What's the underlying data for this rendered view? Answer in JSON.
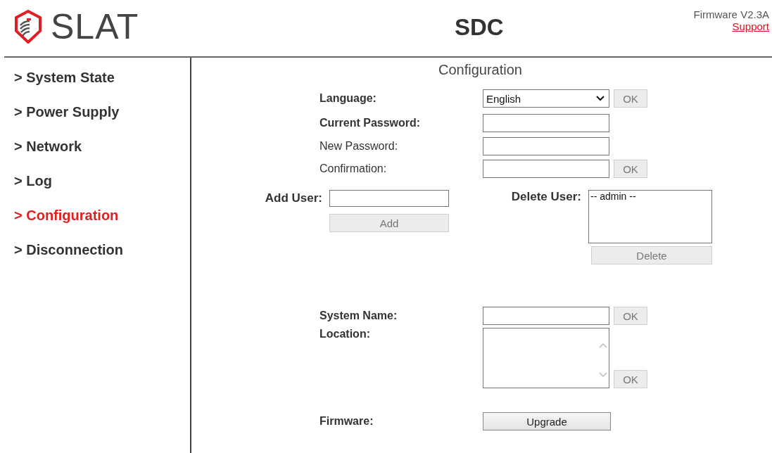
{
  "header": {
    "brand": "SLAT",
    "title": "SDC",
    "firmware": "Firmware V2.3A",
    "support_link": "Support"
  },
  "sidebar": {
    "items": [
      {
        "label": "> System State",
        "selected": false
      },
      {
        "label": "> Power Supply",
        "selected": false
      },
      {
        "label": "> Network",
        "selected": false
      },
      {
        "label": "> Log",
        "selected": false
      },
      {
        "label": "> Configuration",
        "selected": true
      },
      {
        "label": "> Disconnection",
        "selected": false
      }
    ]
  },
  "content": {
    "title": "Configuration",
    "language": {
      "label": "Language:",
      "bold": true,
      "value": "English",
      "button": {
        "label": "OK",
        "disabled": true
      }
    },
    "password_fields": [
      {
        "label": "Current Password:",
        "bold": true
      },
      {
        "label": "New Password:",
        "bold": false
      },
      {
        "label": "Confirmation:",
        "bold": false,
        "button": {
          "label": "OK",
          "disabled": true
        }
      }
    ],
    "add_user": {
      "label": "Add User:",
      "button": {
        "label": "Add",
        "disabled": true
      }
    },
    "delete_user": {
      "label": "Delete User:",
      "options": [
        "-- admin --"
      ],
      "button": {
        "label": "Delete",
        "disabled": true
      }
    },
    "system_name": {
      "label": "System Name:",
      "button": {
        "label": "OK",
        "disabled": true
      }
    },
    "location": {
      "label": "Location:",
      "button": {
        "label": "OK",
        "disabled": true
      }
    },
    "firmware": {
      "label": "Firmware:",
      "button": {
        "label": "Upgrade",
        "disabled": false
      }
    }
  }
}
